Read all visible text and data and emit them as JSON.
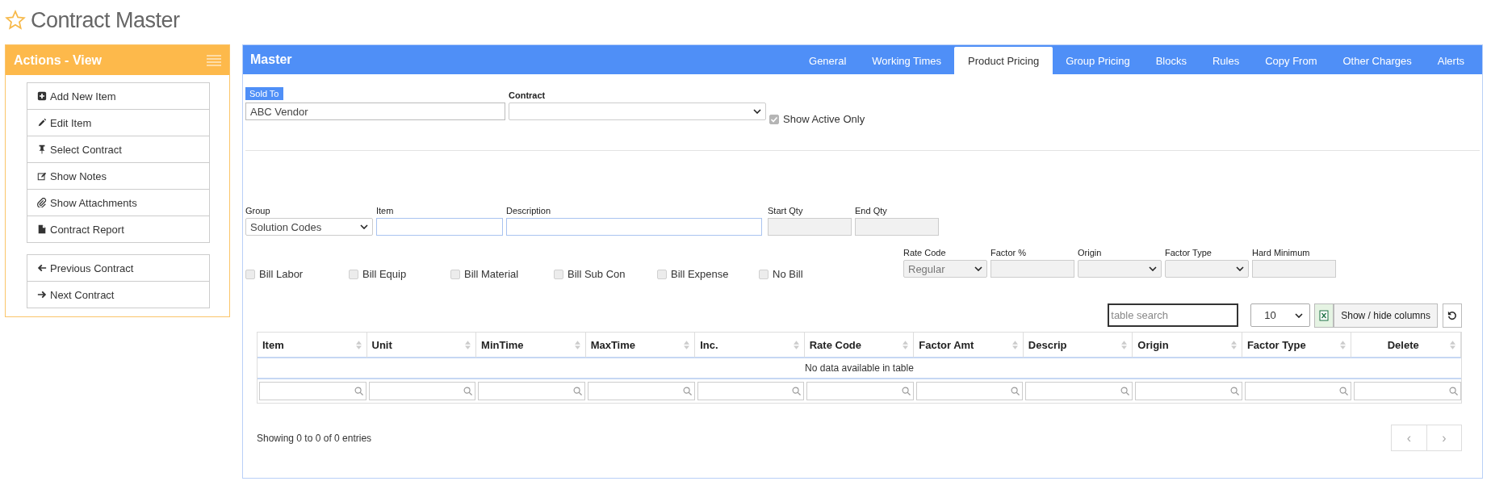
{
  "page": {
    "title": "Contract Master"
  },
  "actions_panel": {
    "title": "Actions - View",
    "groups": [
      [
        {
          "label": "Add New Item",
          "kind": "plus"
        },
        {
          "label": "Edit Item",
          "kind": "pencil"
        },
        {
          "label": "Select Contract",
          "kind": "pin"
        },
        {
          "label": "Show Notes",
          "kind": "note"
        },
        {
          "label": "Show Attachments",
          "kind": "paperclip"
        },
        {
          "label": "Contract Report",
          "kind": "file"
        }
      ],
      [
        {
          "label": "Previous Contract",
          "kind": "arrow-left"
        },
        {
          "label": "Next Contract",
          "kind": "arrow-right"
        }
      ]
    ]
  },
  "master": {
    "title": "Master",
    "tabs": [
      {
        "label": "General",
        "selected": false
      },
      {
        "label": "Working Times",
        "selected": false
      },
      {
        "label": "Product Pricing",
        "selected": true
      },
      {
        "label": "Group Pricing",
        "selected": false
      },
      {
        "label": "Blocks",
        "selected": false
      },
      {
        "label": "Rules",
        "selected": false
      },
      {
        "label": "Copy From",
        "selected": false
      },
      {
        "label": "Other Charges",
        "selected": false
      },
      {
        "label": "Alerts",
        "selected": false
      }
    ],
    "sold_to": {
      "label": "Sold To",
      "value": "ABC Vendor"
    },
    "contract": {
      "label": "Contract"
    },
    "show_active_only": {
      "label": "Show Active Only",
      "checked": true,
      "disabled": true
    },
    "fields": [
      {
        "label": "Group",
        "kind": "select",
        "value": "Solution Codes",
        "disabled": false
      },
      {
        "label": "Item",
        "kind": "text",
        "disabled": false
      },
      {
        "label": "Description",
        "kind": "text",
        "disabled": false
      },
      {
        "label": "Start Qty",
        "kind": "text",
        "disabled": true
      },
      {
        "label": "End Qty",
        "kind": "text",
        "disabled": true
      }
    ],
    "bill_options": [
      {
        "label": "Bill Labor",
        "checked": false,
        "disabled": true
      },
      {
        "label": "Bill Equip",
        "checked": false,
        "disabled": true
      },
      {
        "label": "Bill Material",
        "checked": false,
        "disabled": true
      },
      {
        "label": "Bill Sub Con",
        "checked": false,
        "disabled": true
      },
      {
        "label": "Bill Expense",
        "checked": false,
        "disabled": true
      },
      {
        "label": "No Bill",
        "checked": false,
        "disabled": true
      }
    ],
    "rate_fields": [
      {
        "label": "Rate Code",
        "kind": "select",
        "value": "Regular",
        "disabled": true
      },
      {
        "label": "Factor %",
        "kind": "text",
        "disabled": true
      },
      {
        "label": "Origin",
        "kind": "select",
        "disabled": true
      },
      {
        "label": "Factor Type",
        "kind": "select",
        "disabled": true
      },
      {
        "label": "Hard Minimum",
        "kind": "text",
        "disabled": true
      }
    ],
    "table": {
      "search_placeholder": "table search",
      "page_length": "10",
      "columns_button": "Show / hide columns",
      "columns": [
        "Item",
        "Unit",
        "MinTime",
        "MaxTime",
        "Inc.",
        "Rate Code",
        "Factor Amt",
        "Descrip",
        "Origin",
        "Factor Type",
        "Delete"
      ],
      "empty_message": "No data available in table",
      "info": "Showing 0 to 0 of 0 entries",
      "prev": "‹",
      "next": "›"
    }
  }
}
